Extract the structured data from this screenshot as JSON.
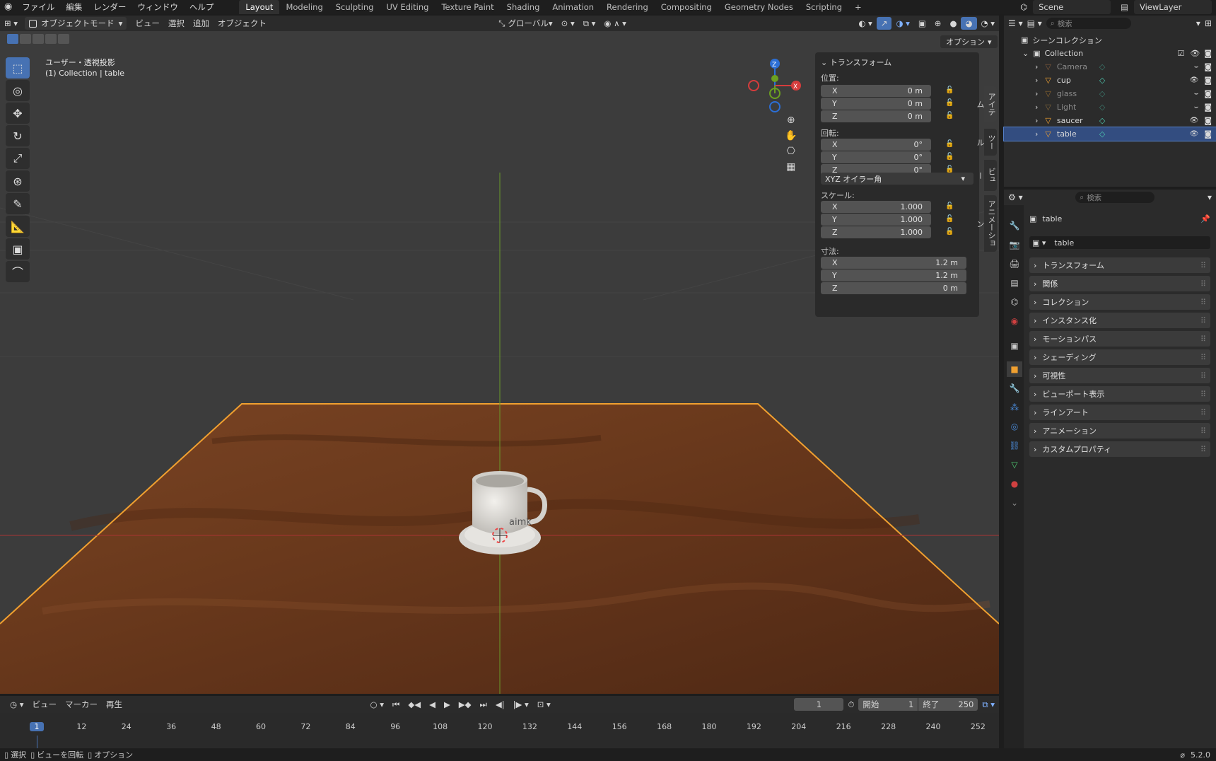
{
  "topbar": {
    "menus": [
      "ファイル",
      "編集",
      "レンダー",
      "ウィンドウ",
      "ヘルプ"
    ],
    "workspaces": [
      "Layout",
      "Modeling",
      "Sculpting",
      "UV Editing",
      "Texture Paint",
      "Shading",
      "Animation",
      "Rendering",
      "Compositing",
      "Geometry Nodes",
      "Scripting"
    ],
    "active_workspace": "Layout",
    "add_tab": "+",
    "scene": "Scene",
    "view_layer": "ViewLayer"
  },
  "viewport_header": {
    "mode": "オブジェクトモード",
    "menus": [
      "ビュー",
      "選択",
      "追加",
      "オブジェクト"
    ],
    "orientation": "グローバル",
    "options": "オプション"
  },
  "viewport": {
    "view_name": "ユーザー・透視投影",
    "collection_info": "(1) Collection | table",
    "mug_text": "aimk"
  },
  "n_panel": {
    "header": "トランスフォーム",
    "location_label": "位置:",
    "location": [
      {
        "axis": "X",
        "value": "0 m"
      },
      {
        "axis": "Y",
        "value": "0 m"
      },
      {
        "axis": "Z",
        "value": "0 m"
      }
    ],
    "rotation_label": "回転:",
    "rotation": [
      {
        "axis": "X",
        "value": "0°"
      },
      {
        "axis": "Y",
        "value": "0°"
      },
      {
        "axis": "Z",
        "value": "0°"
      }
    ],
    "rotation_mode": "XYZ オイラー角",
    "scale_label": "スケール:",
    "scale": [
      {
        "axis": "X",
        "value": "1.000"
      },
      {
        "axis": "Y",
        "value": "1.000"
      },
      {
        "axis": "Z",
        "value": "1.000"
      }
    ],
    "dimensions_label": "寸法:",
    "dimensions": [
      {
        "axis": "X",
        "value": "1.2 m"
      },
      {
        "axis": "Y",
        "value": "1.2 m"
      },
      {
        "axis": "Z",
        "value": "0 m"
      }
    ],
    "tabs": [
      "アイテム",
      "ツール",
      "ビュー",
      "アニメーション"
    ]
  },
  "outliner": {
    "search_placeholder": "検索",
    "scene_collection": "シーンコレクション",
    "collection": "Collection",
    "items": [
      {
        "name": "Camera",
        "dim": true
      },
      {
        "name": "cup",
        "dim": false
      },
      {
        "name": "glass",
        "dim": true
      },
      {
        "name": "Light",
        "dim": true
      },
      {
        "name": "saucer",
        "dim": false
      },
      {
        "name": "table",
        "dim": false,
        "selected": true
      }
    ]
  },
  "properties": {
    "search_placeholder": "検索",
    "object_name": "table",
    "data_name": "table",
    "sections": [
      "トランスフォーム",
      "関係",
      "コレクション",
      "インスタンス化",
      "モーションパス",
      "シェーディング",
      "可視性",
      "ビューポート表示",
      "ラインアート",
      "アニメーション",
      "カスタムプロパティ"
    ]
  },
  "timeline": {
    "menus": [
      "ビュー",
      "マーカー",
      "再生"
    ],
    "current_frame": "1",
    "start_label": "開始",
    "start": "1",
    "end_label": "終了",
    "end": "250",
    "ticks": [
      "1",
      "12",
      "24",
      "36",
      "48",
      "60",
      "72",
      "84",
      "96",
      "108",
      "120",
      "132",
      "144",
      "156",
      "168",
      "180",
      "192",
      "204",
      "216",
      "228",
      "240",
      "252"
    ]
  },
  "statusbar": {
    "items": [
      "選択",
      "ビューを回転",
      "オプション"
    ],
    "version": "5.2.0"
  },
  "colors": {
    "accent": "#4772b3",
    "selection_outline": "#f0a030",
    "table_wood": "#6b3a1e"
  }
}
